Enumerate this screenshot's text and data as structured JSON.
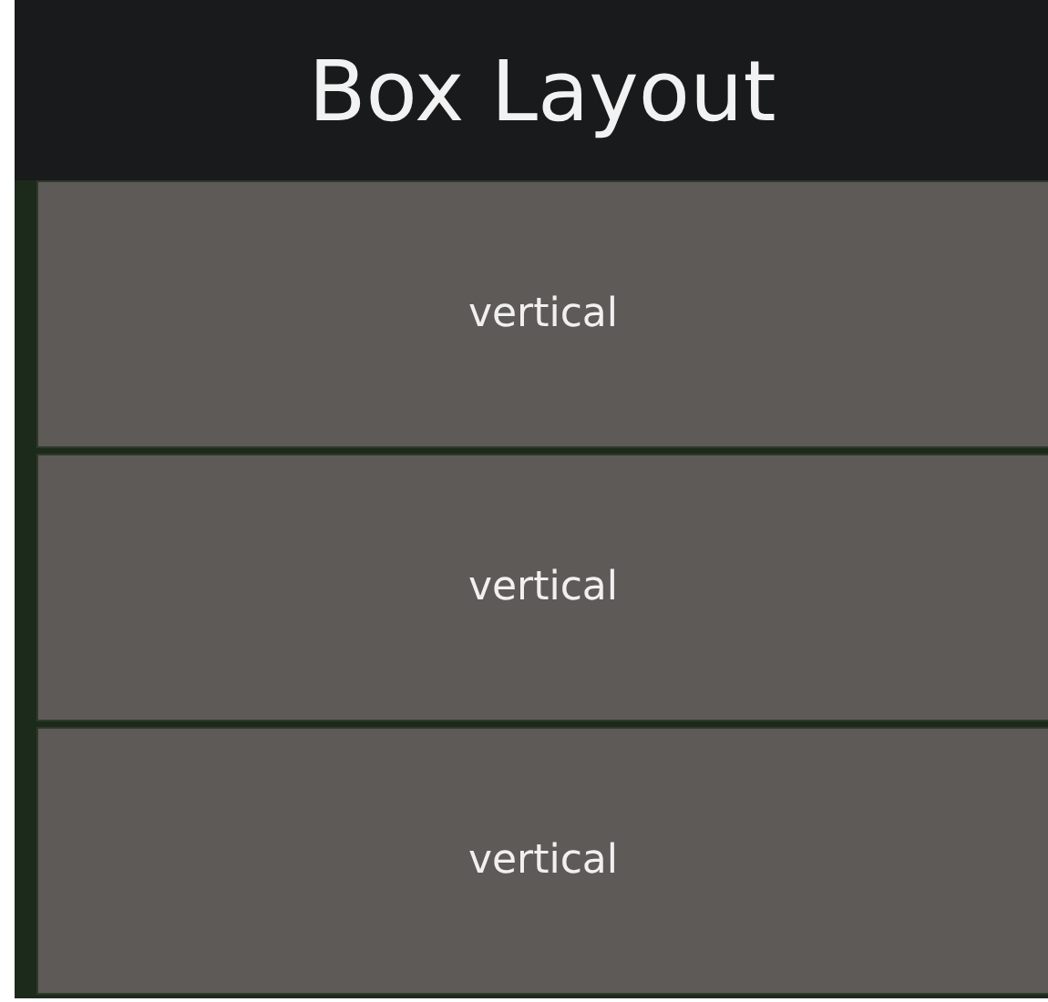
{
  "title": "Box Layout",
  "buttons": [
    {
      "label": "vertical"
    },
    {
      "label": "vertical"
    },
    {
      "label": "vertical"
    }
  ]
}
